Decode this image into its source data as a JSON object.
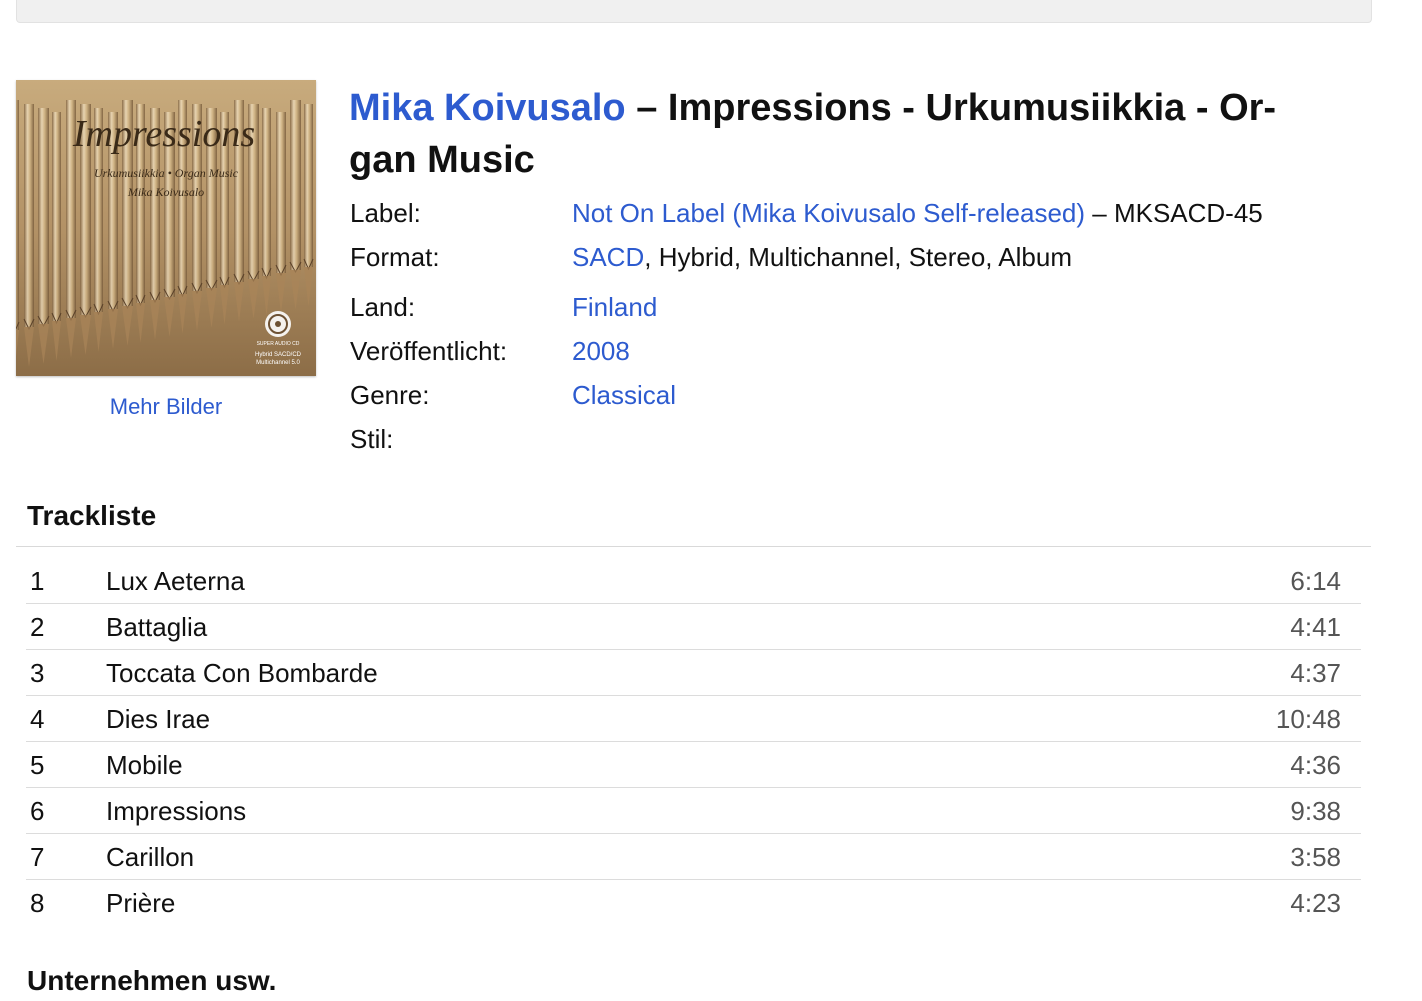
{
  "cover": {
    "title": "Impressions",
    "subtitle": "Urkumusiikkia • Organ Music",
    "artist": "Mika Koivusalo",
    "logo_text": "SUPER AUDIO CD",
    "badge_line1": "Hybrid SACD/CD",
    "badge_line2": "Multichannel 5.0"
  },
  "more_images_label": "Mehr Bilder",
  "release": {
    "artist": "Mika Koivusalo",
    "title_line1": " – Impressions - Urkumusiikkia - Or-",
    "title_line2": "gan Music"
  },
  "info": {
    "label": {
      "key": "Label:",
      "link": "Not On Label (Mika Koivusalo Self-released)",
      "rest": " – MKSACD-45"
    },
    "format": {
      "key": "Format:",
      "link": "SACD",
      "rest": ", Hybrid, Multichannel, Stereo, Album"
    },
    "country": {
      "key": "Land:",
      "link": "Finland"
    },
    "released": {
      "key": "Veröffentlicht:",
      "link": "2008"
    },
    "genre": {
      "key": "Genre:",
      "link": "Classical"
    },
    "style": {
      "key": "Stil:"
    }
  },
  "tracklist": {
    "heading": "Trackliste",
    "tracks": [
      {
        "position": "1",
        "title": "Lux Aeterna",
        "duration": "6:14"
      },
      {
        "position": "2",
        "title": "Battaglia",
        "duration": "4:41"
      },
      {
        "position": "3",
        "title": "Toccata Con Bombarde",
        "duration": "4:37"
      },
      {
        "position": "4",
        "title": "Dies Irae",
        "duration": "10:48"
      },
      {
        "position": "5",
        "title": "Mobile",
        "duration": "4:36"
      },
      {
        "position": "6",
        "title": "Impressions",
        "duration": "9:38"
      },
      {
        "position": "7",
        "title": "Carillon",
        "duration": "3:58"
      },
      {
        "position": "8",
        "title": "Prière",
        "duration": "4:23"
      }
    ]
  },
  "companies_heading": "Unternehmen usw.",
  "colors": {
    "link": "#2d5bcf",
    "text": "#111111",
    "duration": "#555555",
    "cover_gold": "#b89a6a"
  }
}
